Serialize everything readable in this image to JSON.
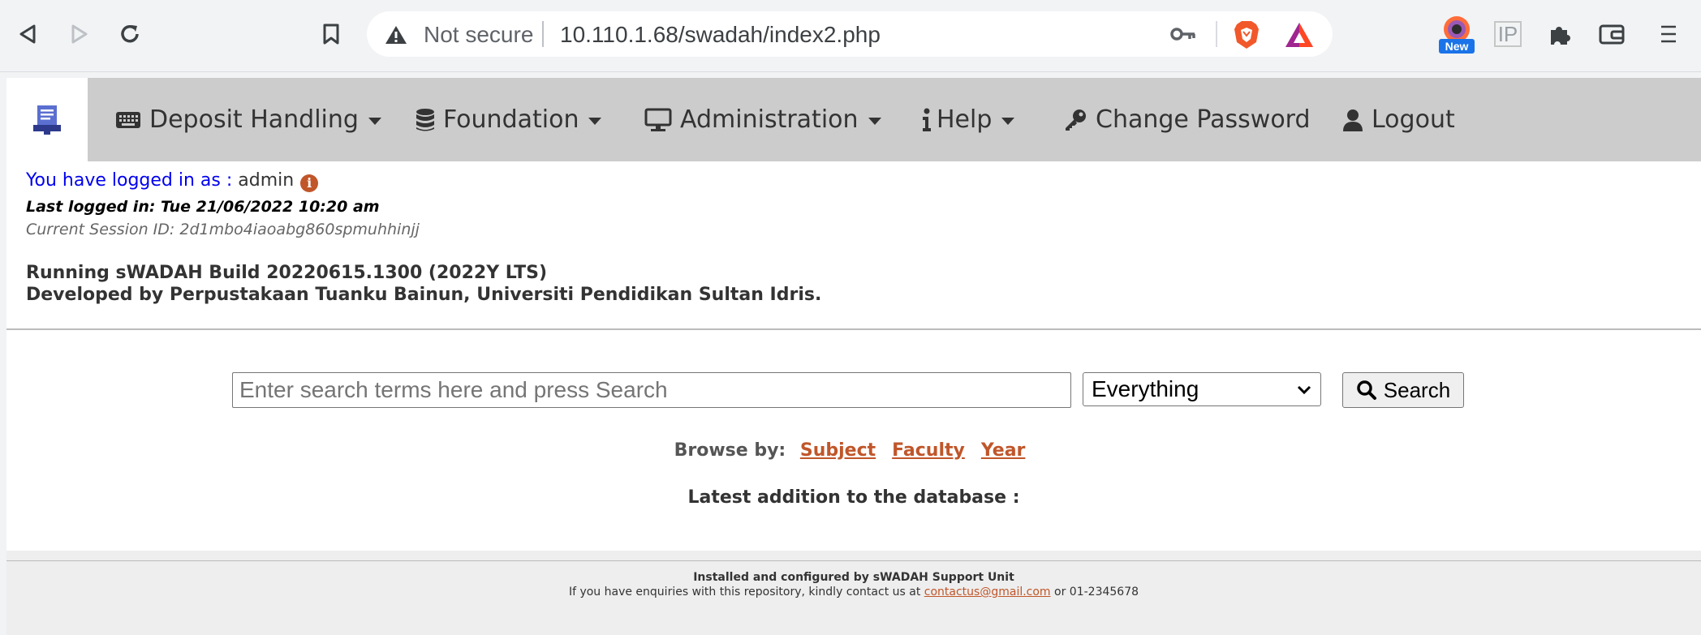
{
  "browser": {
    "security_label": "Not secure",
    "url": "10.110.1.68/swadah/index2.php",
    "extension_badge": "New",
    "ip_label": "IP"
  },
  "navbar": {
    "items": [
      {
        "label": "Deposit Handling",
        "icon": "keyboard-icon",
        "dropdown": true
      },
      {
        "label": "Foundation",
        "icon": "database-icon",
        "dropdown": true
      },
      {
        "label": "Administration",
        "icon": "desktop-icon",
        "dropdown": true
      },
      {
        "label": "Help",
        "icon": "info-icon",
        "dropdown": true
      },
      {
        "label": "Change Password",
        "icon": "key-icon",
        "dropdown": false
      },
      {
        "label": "Logout",
        "icon": "user-icon",
        "dropdown": false
      }
    ]
  },
  "session": {
    "logged_in_prefix": "You have logged in as :",
    "username": "admin",
    "last_login": "Last logged in: Tue 21/06/2022 10:20 am",
    "session_id": "Current Session ID: 2d1mbo4iaoabg860spmuhhinjj",
    "build_line": "Running sWADAH Build 20220615.1300 (2022Y LTS)",
    "developer_line": "Developed by Perpustakaan Tuanku Bainun, Universiti Pendidikan Sultan Idris."
  },
  "search": {
    "placeholder": "Enter search terms here and press Search",
    "scope_selected": "Everything",
    "button_label": "Search"
  },
  "browse": {
    "label": "Browse by:",
    "links": [
      "Subject",
      "Faculty",
      "Year"
    ]
  },
  "latest_label": "Latest addition to the database :",
  "footer": {
    "line1": "Installed and configured by sWADAH Support Unit",
    "line2_prefix": "If you have enquiries with this repository, kindly contact us at",
    "email": "contactus@gmail.com",
    "line2_suffix": "or 01-2345678"
  },
  "colors": {
    "nav_bg": "#cccccc",
    "link_accent": "#c0562a",
    "login_blue": "#0000ee"
  }
}
